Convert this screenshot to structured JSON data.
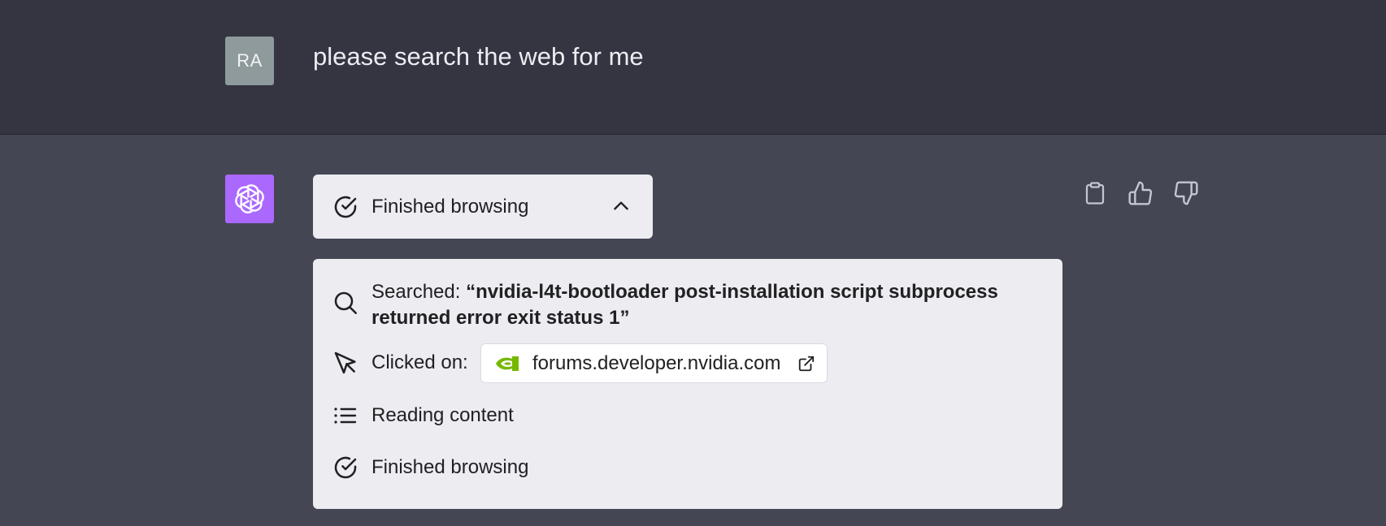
{
  "user_message": {
    "avatar_initials": "RA",
    "text": "please search the web for me"
  },
  "assistant_message": {
    "avatar_icon": "openai-logo-icon",
    "browse_status": {
      "label": "Finished browsing",
      "icon": "check-circle-icon",
      "expanded": true,
      "toggle_icon": "chevron-up-icon"
    },
    "steps": {
      "search": {
        "icon": "search-icon",
        "prefix": "Searched:",
        "query": "“nvidia-l4t-bootloader post-installation script subprocess returned error exit status 1”"
      },
      "clicked": {
        "icon": "cursor-icon",
        "prefix": "Clicked on:",
        "link_domain": "forums.developer.nvidia.com",
        "favicon": "nvidia-logo-icon",
        "link_icon": "external-link-icon"
      },
      "reading": {
        "icon": "list-icon",
        "label": "Reading content"
      },
      "finished": {
        "icon": "check-circle-icon",
        "label": "Finished browsing"
      }
    },
    "actions": [
      "clipboard-icon",
      "thumbs-up-icon",
      "thumbs-down-icon"
    ]
  },
  "colors": {
    "user_row_bg": "#343541",
    "assistant_row_bg": "#444654",
    "user_avatar_bg": "#8e9a9b",
    "assistant_avatar_bg": "#ab68ff",
    "panel_bg": "#ececf1",
    "nvidia_green": "#76b900"
  }
}
